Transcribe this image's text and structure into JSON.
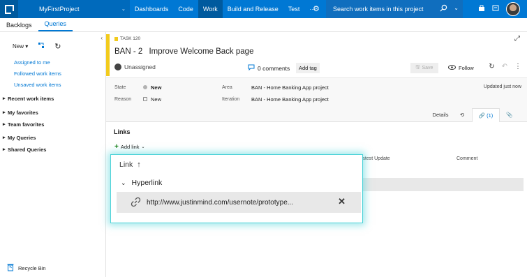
{
  "topbar": {
    "project": "MyFirstProject",
    "nav": [
      "Dashboards",
      "Code",
      "Work",
      "Build and Release",
      "Test",
      "···"
    ],
    "active_nav": "Work",
    "search_placeholder": "Search work items in this project"
  },
  "tabs": [
    "Backlogs",
    "Queries"
  ],
  "sidebar": {
    "new_label": "New",
    "links": [
      "Assigned to me",
      "Followed work items",
      "Unsaved work items"
    ],
    "groups": [
      "Recent work items",
      "My favorites",
      "Team favorites",
      "My Queries",
      "Shared Queries"
    ],
    "recycle": "Recycle Bin"
  },
  "work_item": {
    "type_label": "TASK 120",
    "id": "BAN - 2",
    "title": "Improve Welcome Back page",
    "assigned": "Unassigned",
    "comments": "0 comments",
    "add_tag": "Add tag",
    "save": "Save",
    "follow": "Follow",
    "state_label": "State",
    "state_value": "New",
    "reason_label": "Reason",
    "reason_value": "New",
    "area_label": "Area",
    "area_value": "BAN - Home Banking App project",
    "iteration_label": "Iteration",
    "iteration_value": "BAN - Home Banking App project",
    "updated": "Updated just now"
  },
  "subtabs": {
    "details": "Details",
    "links": "(1)"
  },
  "links_section": {
    "title": "Links",
    "add_link": "Add link",
    "col_latest": "atest Update",
    "col_comment": "Comment"
  },
  "popup": {
    "link_label": "Link",
    "group_label": "Hyperlink",
    "url": "http://www.justinmind.com/usernote/prototype..."
  },
  "colors": {
    "accent": "#0078d4",
    "task_yellow": "#f2cb1d",
    "highlight": "#4fd3d8"
  }
}
